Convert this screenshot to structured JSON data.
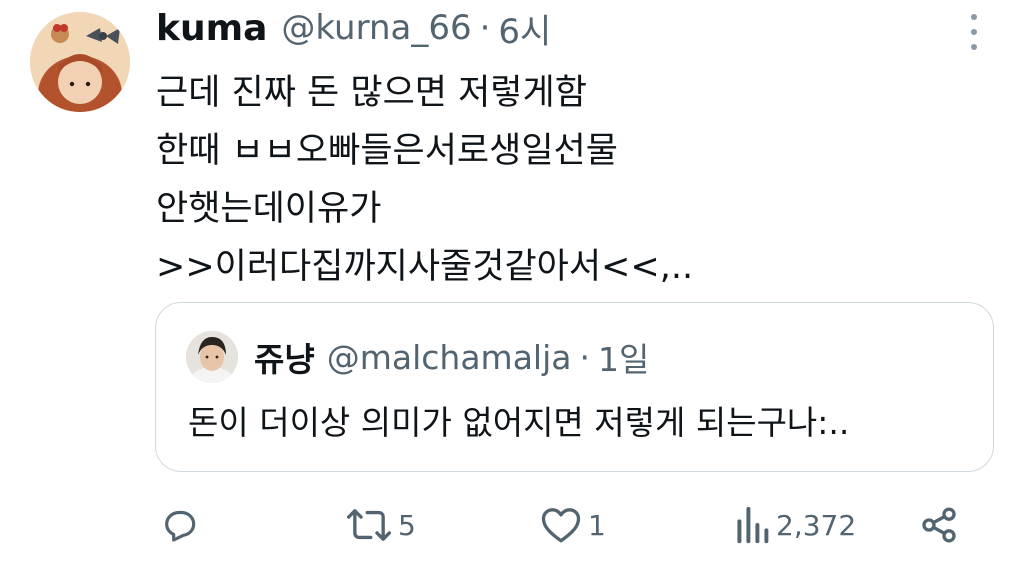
{
  "tweet": {
    "display_name": "kuma",
    "handle": "@kurna_66",
    "separator": "·",
    "time": "6시",
    "lines": [
      "근데 진짜 돈 많으면 저렇게함",
      "한때 ㅂㅂ오빠들은서로생일선물",
      "안햇는데이유가",
      ">>이러다집까지사줄것같아서<<,.."
    ]
  },
  "quote": {
    "display_name": "쥬냥",
    "handle": "@malchamalja",
    "separator": "·",
    "time": "1일",
    "text": "돈이 더이상 의미가 없어지면 저렇게 되는구나:.."
  },
  "actions": {
    "reply_icon": "reply-icon",
    "retweet_icon": "retweet-icon",
    "retweet_count": "5",
    "like_icon": "heart-icon",
    "like_count": "1",
    "views_icon": "views-chart-icon",
    "views_count": "2,372",
    "share_icon": "share-icon",
    "icon_color": "#536471"
  },
  "menu_icon": "more-vertical-icon"
}
